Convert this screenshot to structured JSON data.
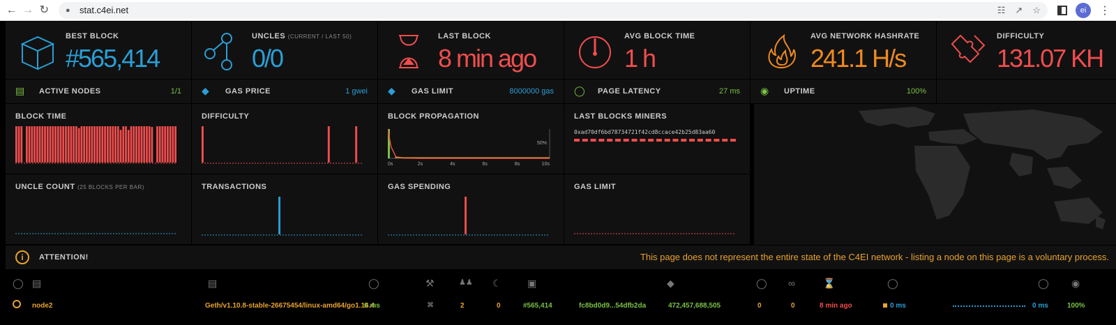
{
  "browser": {
    "url": "stat.c4ei.net",
    "avatar": "ei"
  },
  "stats": [
    {
      "label": "BEST BLOCK",
      "sub": "",
      "value": "#565,414",
      "color": "#2a9fd6",
      "icon": "cube-icon"
    },
    {
      "label": "UNCLES",
      "sub": "(CURRENT / LAST 50)",
      "value": "0/0",
      "color": "#2a9fd6",
      "icon": "uncles-icon"
    },
    {
      "label": "LAST BLOCK",
      "sub": "",
      "value": "8 min ago",
      "color": "#f04d4d",
      "icon": "hourglass-icon"
    },
    {
      "label": "AVG BLOCK TIME",
      "sub": "",
      "value": "1 h",
      "color": "#f04d4d",
      "icon": "gauge-icon"
    },
    {
      "label": "AVG NETWORK HASHRATE",
      "sub": "",
      "value": "241.1 H/s",
      "color": "#f08a1f",
      "icon": "fire-icon"
    },
    {
      "label": "DIFFICULTY",
      "sub": "",
      "value": "131.07 KH",
      "color": "#f04d4d",
      "icon": "puzzle-icon"
    }
  ],
  "smalls": [
    {
      "label": "ACTIVE NODES",
      "value": "1/1",
      "color": "#7bc043",
      "icon": "laptop-icon"
    },
    {
      "label": "GAS PRICE",
      "value": "1 gwei",
      "color": "#2a9fd6",
      "icon": "tag-icon"
    },
    {
      "label": "GAS LIMIT",
      "value": "8000000 gas",
      "color": "#2a9fd6",
      "icon": "tag-icon"
    },
    {
      "label": "PAGE LATENCY",
      "value": "27 ms",
      "color": "#7bc043",
      "icon": "timer-icon"
    },
    {
      "label": "UPTIME",
      "value": "100%",
      "color": "#7bc043",
      "icon": "bulb-icon"
    }
  ],
  "charts": {
    "block_time": "BLOCK TIME",
    "difficulty": "DIFFICULTY",
    "block_propagation": "BLOCK PROPAGATION",
    "last_blocks_miners": "LAST BLOCKS MINERS",
    "miner_address": "0xad70df6bd78734721f42cd8ccace42b25d83aa60",
    "uncle_count": "UNCLE COUNT",
    "uncle_count_sub": "(25 BLOCKS PER BAR)",
    "transactions": "TRANSACTIONS",
    "gas_spending": "GAS SPENDING",
    "gas_limit": "GAS LIMIT",
    "prop_ticks": [
      "0s",
      "2s",
      "4s",
      "6s",
      "8s",
      "10s"
    ],
    "prop_pct": "50%"
  },
  "chart_data": [
    {
      "type": "bar",
      "title": "BLOCK TIME",
      "values": [
        1,
        1,
        1,
        0,
        1,
        1,
        1,
        1,
        1,
        1,
        1,
        1,
        1,
        1,
        1,
        1,
        1,
        1,
        1,
        1,
        1,
        1,
        1,
        1,
        0.95,
        1,
        1,
        1,
        1,
        1,
        1,
        1,
        1,
        1,
        1,
        1,
        1,
        1,
        1,
        1,
        0.9,
        1,
        1,
        0.9,
        1,
        1,
        1,
        1,
        1,
        1,
        1,
        1,
        0.98,
        0,
        1,
        1,
        1,
        1,
        1,
        1,
        1,
        1
      ]
    },
    {
      "type": "bar",
      "title": "DIFFICULTY",
      "values": [
        1,
        0,
        0,
        0,
        0,
        0,
        0,
        0,
        0,
        0,
        0,
        0,
        0,
        0,
        0,
        0,
        0,
        0,
        0,
        0,
        0,
        0,
        0,
        0,
        0,
        0,
        0,
        0,
        0,
        0,
        0,
        0,
        0,
        0,
        0,
        0,
        0,
        0,
        0,
        0,
        0,
        0,
        0,
        0,
        0,
        0,
        1,
        0,
        0,
        0,
        0,
        0,
        0,
        0,
        0,
        0,
        1,
        0,
        0
      ]
    },
    {
      "type": "line",
      "title": "BLOCK PROPAGATION",
      "x": [
        0,
        0.2,
        0.5,
        1,
        2,
        4,
        6,
        8,
        10
      ],
      "y": [
        100,
        40,
        5,
        1,
        0,
        0,
        0,
        0,
        0
      ]
    },
    {
      "type": "bar",
      "title": "TRANSACTIONS",
      "values": [
        0,
        0,
        0,
        0,
        0,
        0,
        0,
        0,
        0,
        0,
        0,
        0,
        0,
        0,
        0,
        0,
        0,
        0,
        0,
        0,
        0,
        0,
        0,
        0,
        0,
        0,
        0,
        0,
        1,
        0,
        0,
        0,
        0,
        0,
        0,
        0,
        0,
        0,
        0,
        0,
        0,
        0,
        0,
        0,
        0,
        0,
        0,
        0,
        0,
        0,
        0,
        0,
        0,
        0,
        0,
        0,
        0,
        0,
        0
      ]
    },
    {
      "type": "bar",
      "title": "GAS SPENDING",
      "values": [
        0,
        0,
        0,
        0,
        0,
        0,
        0,
        0,
        0,
        0,
        0,
        0,
        0,
        0,
        0,
        0,
        0,
        0,
        0,
        0,
        0,
        0,
        0,
        0,
        0,
        0,
        0,
        0,
        1,
        0,
        0,
        0,
        0,
        0,
        0,
        0,
        0,
        0,
        0,
        0,
        0,
        0,
        0,
        0,
        0,
        0,
        0,
        0,
        0,
        0,
        0,
        0,
        0,
        0,
        0,
        0,
        0,
        0,
        0
      ]
    }
  ],
  "attention": {
    "title": "ATTENTION!",
    "message": "This page does not represent the entire state of the C4EI network - listing a node on this page is a voluntary process."
  },
  "node": {
    "name": "node2",
    "client": "Geth/v1.10.8-stable-26675454/linux-amd64/go1.16.4",
    "latency": "0 ms",
    "peers": "2",
    "pending": "0",
    "block": "#565,414",
    "hash": "fc8bd0d9...54dfb2da",
    "difficulty": "472,457,688,505",
    "uncles": "0",
    "txs": "0",
    "last_block": "8 min ago",
    "prop_avg": "0 ms",
    "propagation": "0 ms",
    "uptime": "100%"
  }
}
